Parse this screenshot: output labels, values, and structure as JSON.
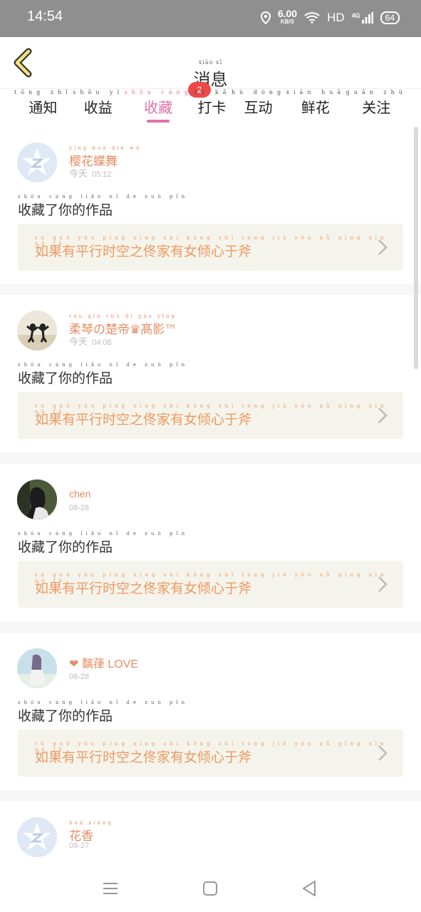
{
  "status_bar": {
    "time": "14:54",
    "speed": "6.00",
    "speed_unit": "KB/S",
    "network": "HD",
    "signal_type": "4G",
    "battery": "64"
  },
  "header": {
    "title": "消息",
    "title_pinyin": "xiāo xī"
  },
  "tabs": [
    {
      "label": "通知",
      "pinyin": "tōng zhī",
      "active": false
    },
    {
      "label": "收益",
      "pinyin": "shōu yì",
      "active": false
    },
    {
      "label": "收藏",
      "pinyin": "shōu cáng",
      "active": true,
      "badge": "2"
    },
    {
      "label": "打卡",
      "pinyin": "dǎ kǎ",
      "active": false
    },
    {
      "label": "互动",
      "pinyin": "hù dòng",
      "active": false
    },
    {
      "label": "鲜花",
      "pinyin": "xiān huā",
      "active": false
    },
    {
      "label": "关注",
      "pinyin": "guān zhù",
      "active": false
    }
  ],
  "messages": [
    {
      "name": "樱花蝶舞",
      "name_pinyin": "yīng huā dié wǔ",
      "date_prefix": "今天",
      "time": "05:12",
      "action": "收藏了你的作品",
      "action_pinyin": "shōu cáng liǎo nǐ de zuò pǐn",
      "work": "如果有平行时空之佟家有女倾心于斧",
      "work_pinyin": "rú guǒ yǒu píng xíng shí kōng zhī tóng jiā yǒu nǚ qīng xīn yú fǔ"
    },
    {
      "name": "柔琴の楚帝♛髙影™",
      "name_pinyin": "róu qín chǔ dì gāo yǐng",
      "date_prefix": "今天",
      "time": "04:08",
      "action": "收藏了你的作品",
      "action_pinyin": "shōu cáng liǎo nǐ de zuò pǐn",
      "work": "如果有平行时空之佟家有女倾心于斧",
      "work_pinyin": "rú guǒ yǒu píng xíng shí kōng zhī tóng jiā yǒu nǚ qīng xīn yú fǔ"
    },
    {
      "name": "chen",
      "name_pinyin": "",
      "date_prefix": "",
      "time": "08-28",
      "action": "收藏了你的作品",
      "action_pinyin": "shōu cáng liǎo nǐ de zuò pǐn",
      "work": "如果有平行时空之佟家有女倾心于斧",
      "work_pinyin": "rú guǒ yǒu píng xíng shí kōng zhī tóng jiā yǒu nǚ qīng xīn yú fǔ"
    },
    {
      "name": "❤ 黐葎 LOVE",
      "name_pinyin": "",
      "date_prefix": "",
      "time": "08-28",
      "action": "收藏了你的作品",
      "action_pinyin": "shōu cáng liǎo nǐ de zuò pǐn",
      "work": "如果有平行时空之佟家有女倾心于斧",
      "work_pinyin": "rú guǒ yǒu píng xíng shí kōng zhī tóng jiā yǒu nǚ qīng xīn yú fǔ"
    },
    {
      "name": "花香",
      "name_pinyin": "huā xiāng",
      "date_prefix": "",
      "time": "08-27"
    }
  ],
  "colors": {
    "accent": "#e070a8",
    "name": "#e58d64",
    "work_text": "#f0995f",
    "badge": "#f04848",
    "status_bar": "#8f8f8f"
  }
}
